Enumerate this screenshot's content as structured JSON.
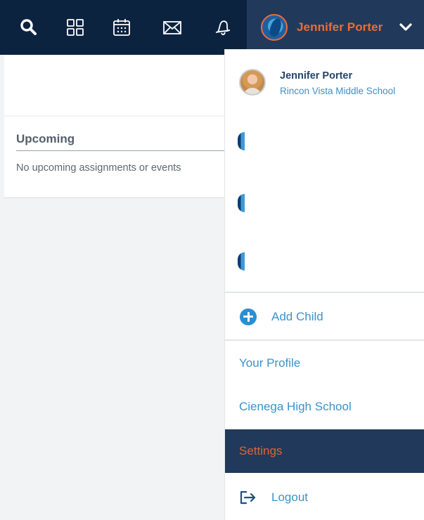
{
  "topbar": {
    "icons": [
      "search-icon",
      "grid-icon",
      "calendar-icon",
      "mail-icon",
      "bell-icon"
    ],
    "user_name": "Jennifer Porter",
    "colors": {
      "bar": "#0c2340",
      "user_zone": "#213a5b",
      "accent": "#f06b32"
    }
  },
  "main": {
    "upcoming_title": "Upcoming",
    "upcoming_empty": "No upcoming assignments or events"
  },
  "dropdown": {
    "profile_name": "Jennifer Porter",
    "profile_school": "Rincon Vista Middle School",
    "children_count": 3,
    "add_child_label": "Add Child",
    "your_profile_label": "Your Profile",
    "school_link_label": "Cienega High School",
    "settings_label": "Settings",
    "logout_label": "Logout",
    "colors": {
      "link": "#3a93c9",
      "selected_bg": "#213a5b",
      "selected_text": "#e0633a"
    }
  }
}
